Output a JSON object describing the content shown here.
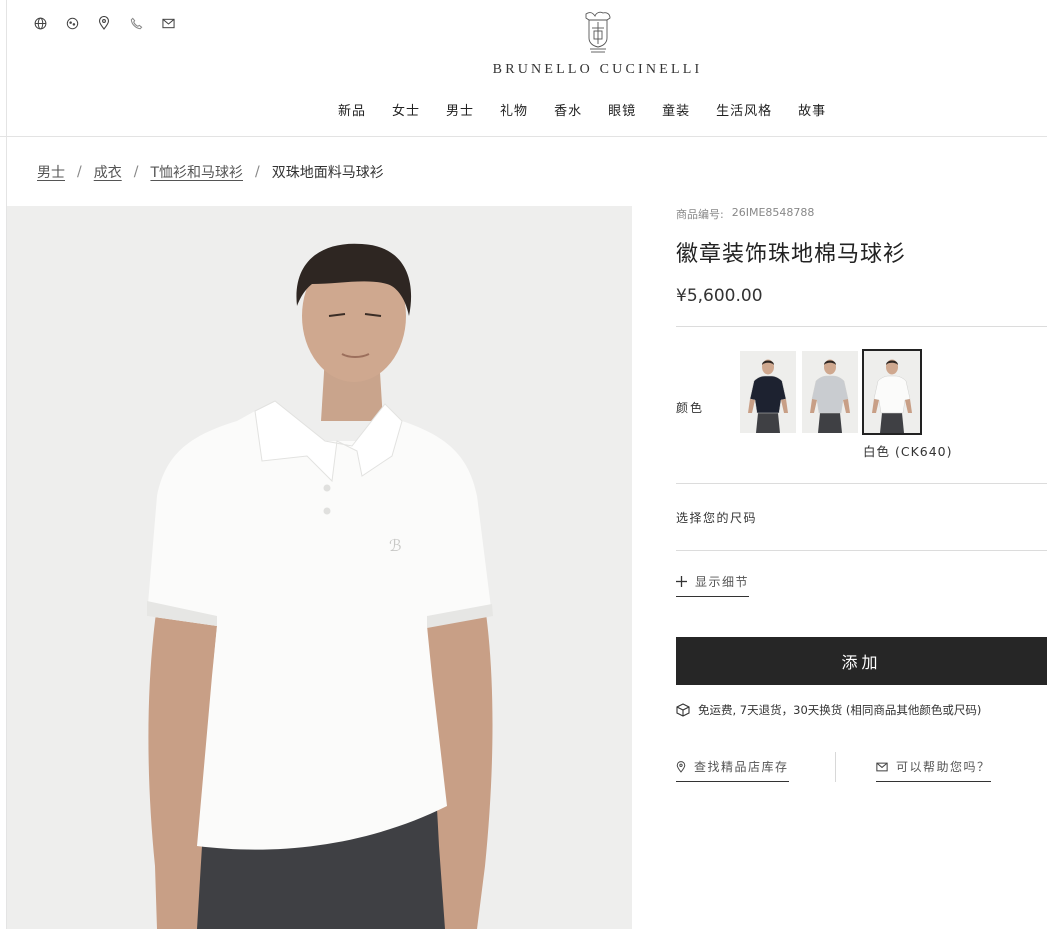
{
  "header": {
    "utility_icons": [
      "globe-icon",
      "chat-icon",
      "location-icon",
      "phone-icon",
      "mail-icon"
    ],
    "brand": "BRUNELLO CUCINELLI",
    "nav": [
      "新品",
      "女士",
      "男士",
      "礼物",
      "香水",
      "眼镜",
      "童装",
      "生活风格",
      "故事"
    ]
  },
  "breadcrumb": {
    "items": [
      "男士",
      "成衣",
      "T恤衫和马球衫"
    ],
    "separator": "/",
    "current": "双珠地面料马球衫"
  },
  "product": {
    "sku_label": "商品编号:",
    "sku_value": "26IME8548788",
    "title": "徽章装饰珠地棉马球衫",
    "price": "¥5,600.00",
    "color_label": "颜色",
    "swatches": [
      {
        "name": "navy",
        "shirt_color": "#1d2230",
        "selected": false
      },
      {
        "name": "light-grey",
        "shirt_color": "#c9ccd0",
        "selected": false
      },
      {
        "name": "white",
        "shirt_color": "#fbfbfa",
        "selected": true
      }
    ],
    "selected_color": "白色 (CK640)",
    "size_prompt": "选择您的尺码",
    "details_link": "显示细节",
    "add_button": "添加",
    "shipping_note": "免运费, 7天退货，30天换货 (相同商品其他颜色或尺码)",
    "store_link": "查找精品店库存",
    "help_link": "可以帮助您吗？"
  },
  "colors": {
    "button_bg": "#262626",
    "image_bg": "#eeeeed",
    "trousers": "#3f4044"
  }
}
